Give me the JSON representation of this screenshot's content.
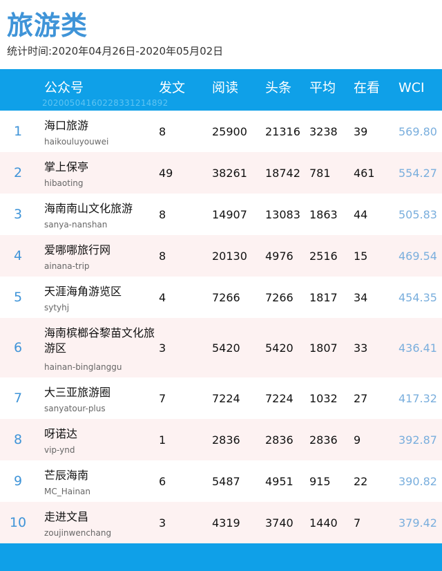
{
  "title": "旅游类",
  "subtitle": "统计时间:2020年04月26日-2020年05月02日",
  "header": {
    "col_account": "公众号",
    "col_posts": "发文",
    "col_reads": "阅读",
    "col_headline": "头条",
    "col_avg": "平均",
    "col_watching": "在看",
    "col_wci": "WCI",
    "code": "20200504160228331214892"
  },
  "rows": [
    {
      "rank": "1",
      "name": "海口旅游",
      "account": "haikouluyouwei",
      "posts": "8",
      "reads": "25900",
      "headline": "21316",
      "avg": "3238",
      "watching": "39",
      "wci": "569.80"
    },
    {
      "rank": "2",
      "name": "掌上保亭",
      "account": "hibaoting",
      "posts": "49",
      "reads": "38261",
      "headline": "18742",
      "avg": "781",
      "watching": "461",
      "wci": "554.27"
    },
    {
      "rank": "3",
      "name": "海南南山文化旅游",
      "account": "sanya-nanshan",
      "posts": "8",
      "reads": "14907",
      "headline": "13083",
      "avg": "1863",
      "watching": "44",
      "wci": "505.83"
    },
    {
      "rank": "4",
      "name": "爱哪哪旅行网",
      "account": "ainana-trip",
      "posts": "8",
      "reads": "20130",
      "headline": "4976",
      "avg": "2516",
      "watching": "15",
      "wci": "469.54"
    },
    {
      "rank": "5",
      "name": "天涯海角游览区",
      "account": "sytyhj",
      "posts": "4",
      "reads": "7266",
      "headline": "7266",
      "avg": "1817",
      "watching": "34",
      "wci": "454.35"
    },
    {
      "rank": "6",
      "name": "海南槟榔谷黎苗文化旅游区",
      "account": "hainan-binglanggu",
      "posts": "3",
      "reads": "5420",
      "headline": "5420",
      "avg": "1807",
      "watching": "33",
      "wci": "436.41"
    },
    {
      "rank": "7",
      "name": "大三亚旅游圈",
      "account": "sanyatour-plus",
      "posts": "7",
      "reads": "7224",
      "headline": "7224",
      "avg": "1032",
      "watching": "27",
      "wci": "417.32"
    },
    {
      "rank": "8",
      "name": "呀诺达",
      "account": "vip-ynd",
      "posts": "1",
      "reads": "2836",
      "headline": "2836",
      "avg": "2836",
      "watching": "9",
      "wci": "392.87"
    },
    {
      "rank": "9",
      "name": "芒辰海南",
      "account": "MC_Hainan",
      "posts": "6",
      "reads": "5487",
      "headline": "4951",
      "avg": "915",
      "watching": "22",
      "wci": "390.82"
    },
    {
      "rank": "10",
      "name": "走进文昌",
      "account": "zoujinwenchang",
      "posts": "3",
      "reads": "4319",
      "headline": "3740",
      "avg": "1440",
      "watching": "7",
      "wci": "379.42"
    }
  ],
  "colors": {
    "accent": "#0fa0e8",
    "title": "#3f94d8",
    "wci": "#79aedd",
    "row_alt": "#fdf2f2"
  }
}
